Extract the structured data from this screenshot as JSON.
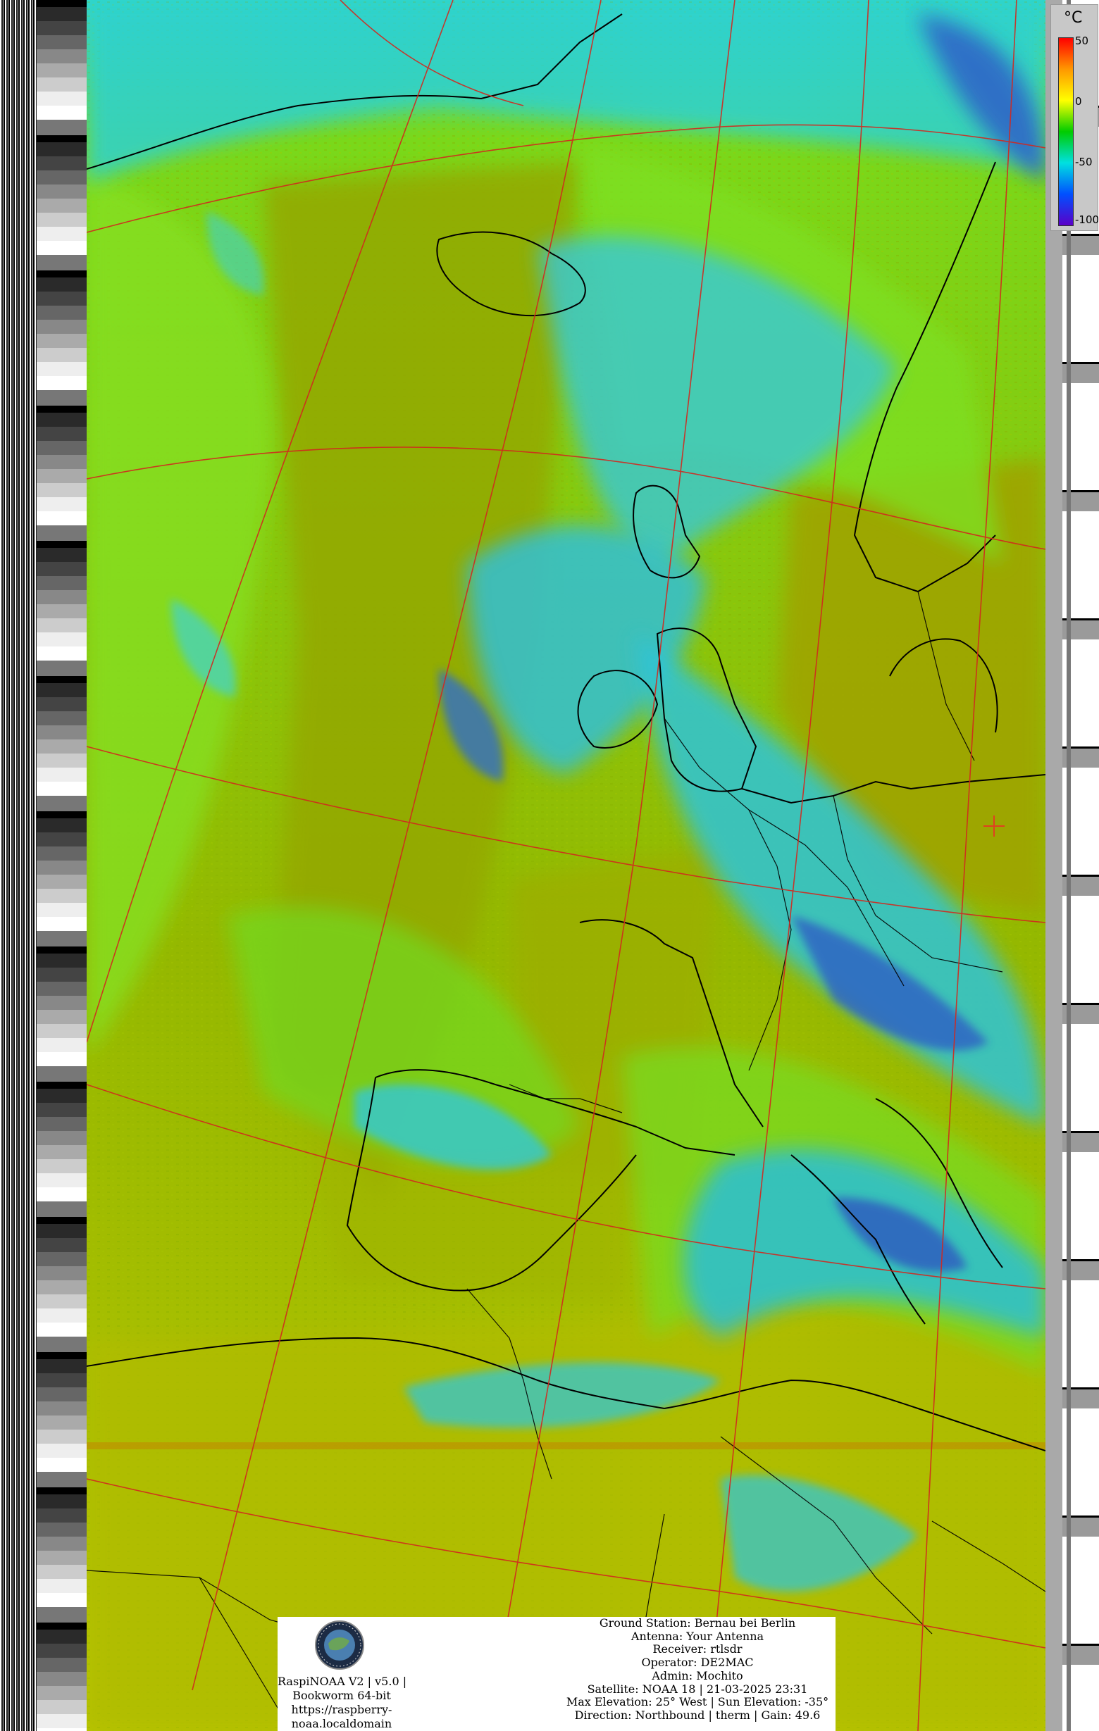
{
  "legend": {
    "unit": "°C",
    "ticks": [
      "50",
      "0",
      "-50",
      "-100"
    ],
    "colors": [
      "#ff0000",
      "#ff9800",
      "#ffff00",
      "#00cc00",
      "#00e0e0",
      "#0050ff",
      "#5a00c8"
    ]
  },
  "info": {
    "software": [
      "RaspiNOAA V2 | v5.0 |",
      "Bookworm 64-bit",
      "https://raspberry-",
      "noaa.localdomain"
    ],
    "ground_station": "Ground Station: Bernau bei Berlin",
    "antenna": "Antenna: Your Antenna",
    "receiver": "Receiver: rtlsdr",
    "operator": "Operator: DE2MAC",
    "admin": "Admin: Mochito",
    "satellite": "Satellite: NOAA 18 | 21-03-2025 23:31",
    "elevation": "Max Elevation: 25° West | Sun Elevation: -35°",
    "direction": "Direction: Northbound | therm | Gain: 49.6"
  },
  "colors": {
    "warm_surface": "#9aa000",
    "mid_cloud": "#7ad81a",
    "cold_cloud": "#28c8d6",
    "very_cold_cloud": "#2f68c0",
    "graticule": "#d2281e",
    "coastline": "#000000",
    "marker": "#e04020"
  },
  "image_type": "NOAA APT thermal (therm) enhanced satellite image of Europe and the North Atlantic"
}
